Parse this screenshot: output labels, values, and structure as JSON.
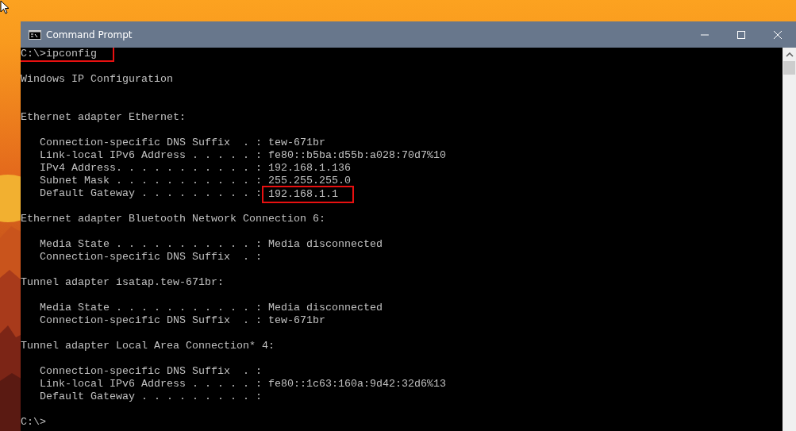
{
  "window": {
    "title": "Command Prompt"
  },
  "console": {
    "lines": [
      {
        "kind": "text",
        "text": "C:\\>ipconfig",
        "highlighted": true
      },
      {
        "kind": "blank"
      },
      {
        "kind": "text",
        "text": "Windows IP Configuration",
        "highlighted": false
      },
      {
        "kind": "blank"
      },
      {
        "kind": "blank"
      },
      {
        "kind": "text",
        "text": "Ethernet adapter Ethernet:",
        "highlighted": false
      },
      {
        "kind": "blank"
      },
      {
        "kind": "property",
        "label": "Connection-specific DNS Suffix  . :",
        "value": "tew-671br",
        "highlighted": false
      },
      {
        "kind": "property",
        "label": "Link-local IPv6 Address . . . . . :",
        "value": "fe80::b5ba:d55b:a028:70d7%10",
        "highlighted": false
      },
      {
        "kind": "property",
        "label": "IPv4 Address. . . . . . . . . . . :",
        "value": "192.168.1.136",
        "highlighted": false
      },
      {
        "kind": "property",
        "label": "Subnet Mask . . . . . . . . . . . :",
        "value": "255.255.255.0",
        "highlighted": false
      },
      {
        "kind": "property",
        "label": "Default Gateway . . . . . . . . . :",
        "value": "192.168.1.1",
        "highlighted": true
      },
      {
        "kind": "blank"
      },
      {
        "kind": "text",
        "text": "Ethernet adapter Bluetooth Network Connection 6:",
        "highlighted": false
      },
      {
        "kind": "blank"
      },
      {
        "kind": "property",
        "label": "Media State . . . . . . . . . . . :",
        "value": "Media disconnected",
        "highlighted": false
      },
      {
        "kind": "property",
        "label": "Connection-specific DNS Suffix  . :",
        "highlighted": false
      },
      {
        "kind": "blank"
      },
      {
        "kind": "text",
        "text": "Tunnel adapter isatap.tew-671br:",
        "highlighted": false
      },
      {
        "kind": "blank"
      },
      {
        "kind": "property",
        "label": "Media State . . . . . . . . . . . :",
        "value": "Media disconnected",
        "highlighted": false
      },
      {
        "kind": "property",
        "label": "Connection-specific DNS Suffix  . :",
        "value": "tew-671br",
        "highlighted": false
      },
      {
        "kind": "blank"
      },
      {
        "kind": "text",
        "text": "Tunnel adapter Local Area Connection* 4:",
        "highlighted": false
      },
      {
        "kind": "blank"
      },
      {
        "kind": "property",
        "label": "Connection-specific DNS Suffix  . :",
        "highlighted": false
      },
      {
        "kind": "property",
        "label": "Link-local IPv6 Address . . . . . :",
        "value": "fe80::1c63:160a:9d42:32d6%13",
        "highlighted": false
      },
      {
        "kind": "property",
        "label": "Default Gateway . . . . . . . . . :",
        "highlighted": false
      },
      {
        "kind": "blank"
      },
      {
        "kind": "text",
        "text": "C:\\>",
        "highlighted": false
      }
    ]
  }
}
